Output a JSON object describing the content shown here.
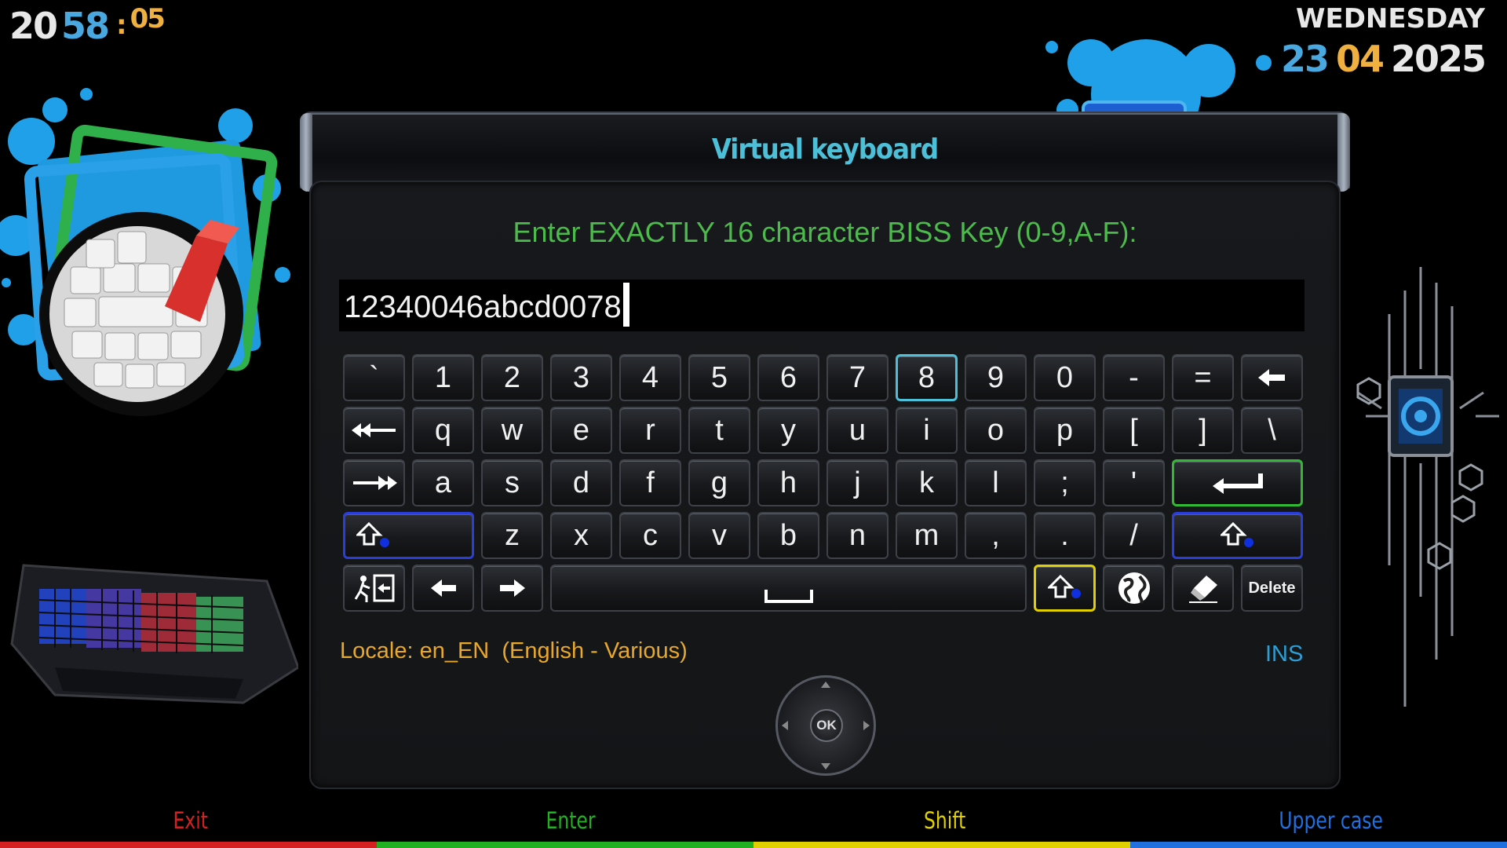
{
  "clock": {
    "hours": "20",
    "minutes": "58",
    "separator": ":",
    "seconds": "05"
  },
  "date": {
    "weekday": "WEDNESDAY",
    "day": "23",
    "month": "04",
    "year": "2025"
  },
  "panel": {
    "title": "Virtual keyboard",
    "prompt": "Enter EXACTLY 16 character BISS Key (0-9,A-F):",
    "input_value": "12340046abcd0078"
  },
  "keyboard": {
    "row1": [
      "`",
      "1",
      "2",
      "3",
      "4",
      "5",
      "6",
      "7",
      "8",
      "9",
      "0",
      "-",
      "="
    ],
    "row2": [
      "q",
      "w",
      "e",
      "r",
      "t",
      "y",
      "u",
      "i",
      "o",
      "p",
      "[",
      "]",
      "\\"
    ],
    "row3": [
      "a",
      "s",
      "d",
      "f",
      "g",
      "h",
      "j",
      "k",
      "l",
      ";",
      "'"
    ],
    "row4": [
      "z",
      "x",
      "c",
      "v",
      "b",
      "n",
      "m",
      ",",
      ".",
      "/"
    ],
    "selected_key": "8",
    "delete_label": "Delete",
    "icons": {
      "backspace": "backspace-arrow-icon",
      "tab_left": "tab-left-icon",
      "tab_right": "tab-right-icon",
      "enter": "enter-icon",
      "shift_left": "shift-icon",
      "shift_right": "shift-icon",
      "exit": "exit-icon",
      "cursor_left": "arrow-left-icon",
      "cursor_right": "arrow-right-icon",
      "space": "space-icon",
      "caps": "caps-lock-icon",
      "locale": "globe-icon",
      "clear": "eraser-icon"
    }
  },
  "locale_text": "Locale: en_EN  (English - Various)",
  "mode_indicator": "INS",
  "remote": {
    "ok_label": "OK"
  },
  "footer": {
    "red": {
      "label": "Exit",
      "color": "#d42020"
    },
    "green": {
      "label": "Enter",
      "color": "#20b020"
    },
    "yellow": {
      "label": "Shift",
      "color": "#e0d000"
    },
    "blue": {
      "label": "Upper case",
      "color": "#2070e0"
    }
  },
  "colors": {
    "title": "#4cc0d8",
    "prompt": "#4cbb4c",
    "locale": "#e8a82c",
    "ins": "#2c9fd8",
    "selected_border": "#4cc0d8"
  }
}
